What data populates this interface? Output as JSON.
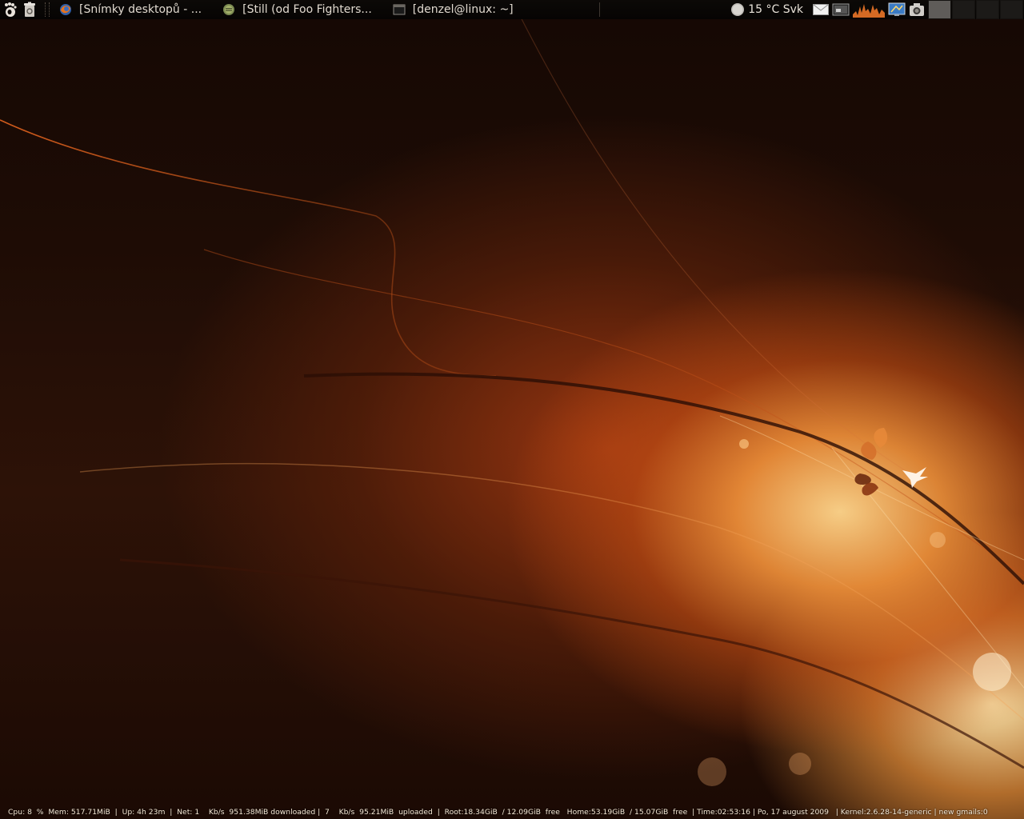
{
  "top_panel": {
    "launchers": [
      {
        "icon": "gnome-foot-icon"
      },
      {
        "icon": "trash-icon"
      }
    ],
    "tasks": [
      {
        "label": "[Snímky desktopů - ...",
        "icon": "firefox-icon"
      },
      {
        "label": "[Still (od Foo Fighters...",
        "icon": "media-player-icon"
      },
      {
        "label": "[denzel@linux: ~]",
        "icon": "terminal-icon"
      }
    ],
    "weather": {
      "text": "15 °C Svk",
      "icon": "weather-cloudy-icon"
    },
    "tray_icons": [
      "mail-icon",
      "network-monitor-icon",
      "cpu-graph-icon",
      "display-icon",
      "camera-icon"
    ],
    "workspaces": {
      "count": 4,
      "active": 0
    }
  },
  "status_bar": {
    "text": "Cpu: 8  %  Mem: 517.71MiB  |  Up: 4h 23m  |  Net: 1    Kb/s  951.38MiB downloaded |  7    Kb/s  95.21MiB  uploaded  |  Root:18.34GiB  / 12.09GiB  free   Home:53.19GiB  / 15.07GiB  free  | Time:02:53:16 | Po, 17 august 2009   | Kernel:2.6.28-14-generic | new gmails:0"
  },
  "colors": {
    "panel_bg": "#060403",
    "wallpaper_glow": "#f6a04a",
    "wallpaper_dark": "#1b0a04",
    "accent_line": "#e8651e"
  }
}
